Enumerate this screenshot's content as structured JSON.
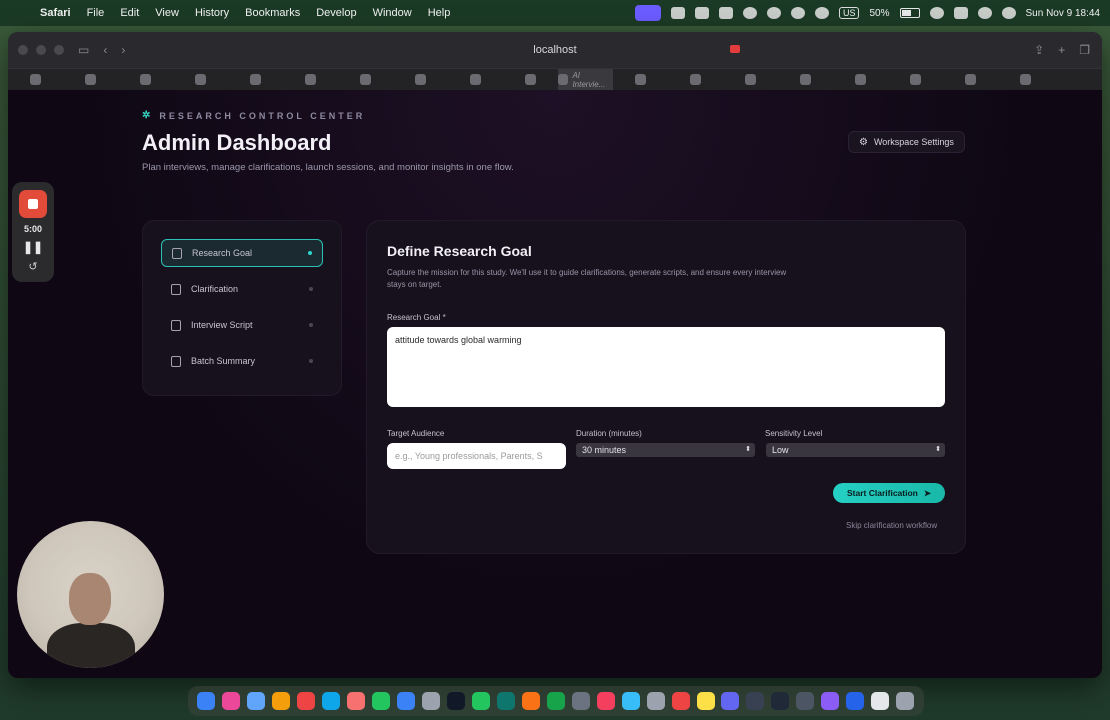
{
  "menubar": {
    "app": "Safari",
    "items": [
      "File",
      "Edit",
      "View",
      "History",
      "Bookmarks",
      "Develop",
      "Window",
      "Help"
    ],
    "battery": "50%",
    "input_source": "US",
    "datetime": "Sun Nov 9  18:44"
  },
  "browser": {
    "url": "localhost",
    "active_tab_title": "AI Intervie..."
  },
  "header": {
    "eyebrow": "RESEARCH CONTROL CENTER",
    "title": "Admin Dashboard",
    "subtitle": "Plan interviews, manage clarifications, launch sessions, and monitor insights in one flow.",
    "settings_label": "Workspace Settings"
  },
  "steps": [
    {
      "label": "Research Goal",
      "active": true
    },
    {
      "label": "Clarification",
      "active": false
    },
    {
      "label": "Interview Script",
      "active": false
    },
    {
      "label": "Batch Summary",
      "active": false
    }
  ],
  "form": {
    "heading": "Define Research Goal",
    "description": "Capture the mission for this study. We'll use it to guide clarifications, generate scripts, and ensure every interview stays on target.",
    "goal_label": "Research Goal *",
    "goal_value": "attitude towards global warming",
    "audience_label": "Target Audience",
    "audience_placeholder": "e.g., Young professionals, Parents, S",
    "duration_label": "Duration (minutes)",
    "duration_value": "30 minutes",
    "sensitivity_label": "Sensitivity Level",
    "sensitivity_value": "Low",
    "start_label": "Start Clarification",
    "skip_label": "Skip clarification workflow"
  },
  "recorder": {
    "time": "5:00"
  },
  "colors": {
    "accent": "#25d0c4",
    "page_bg": "#0f0814",
    "card_bg": "#17111d"
  }
}
